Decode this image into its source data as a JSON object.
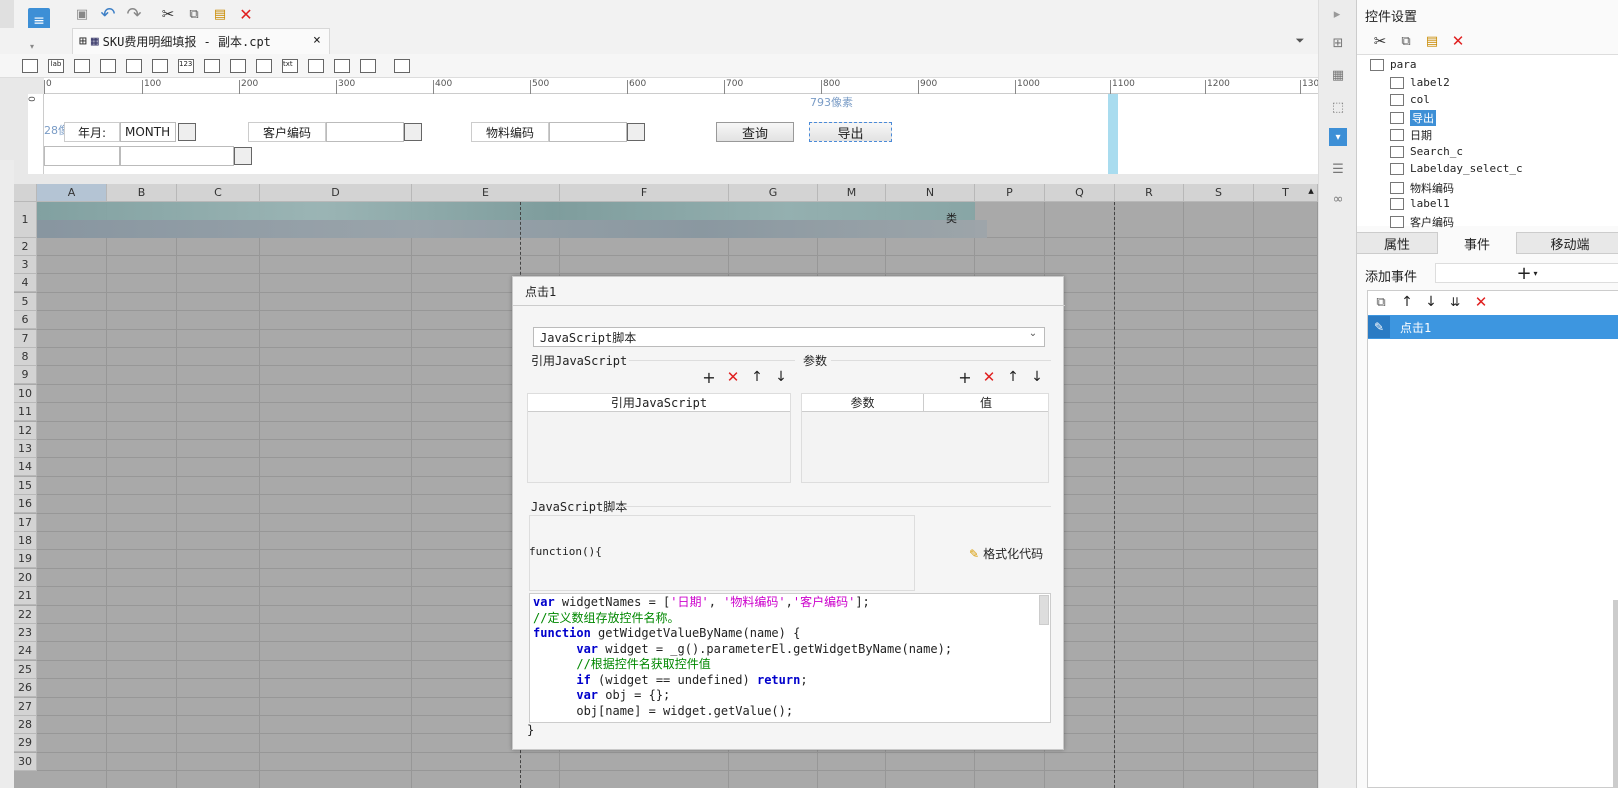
{
  "window": {
    "doc_tab_title": "SKU费用明细填报 - 副本.cpt",
    "tab_close": "×"
  },
  "ruler": {
    "ticks": [
      "0",
      "100",
      "200",
      "300",
      "400",
      "500",
      "600",
      "700",
      "800",
      "900",
      "1000",
      "1100",
      "1200",
      "130"
    ],
    "left": "0"
  },
  "param": {
    "px793": "793像素",
    "px28": "28像素",
    "label_yearmonth": "年月:",
    "yearmonth_value": "MONTH",
    "label_customer": "客户编码",
    "label_material": "物料编码",
    "btn_query": "查询",
    "btn_export": "导出"
  },
  "grid": {
    "columns": [
      "A",
      "B",
      "C",
      "D",
      "E",
      "F",
      "G",
      "M",
      "N",
      "P",
      "Q",
      "R",
      "S",
      "T"
    ],
    "rows": [
      "1",
      "2",
      "3",
      "4",
      "5",
      "6",
      "7",
      "8",
      "9",
      "10",
      "11",
      "12",
      "13",
      "14",
      "15",
      "16",
      "17",
      "18",
      "19",
      "20",
      "21",
      "22",
      "23",
      "24",
      "25",
      "26",
      "27",
      "28",
      "29",
      "30"
    ],
    "cell_suffix": "类"
  },
  "dialog": {
    "title": "点击1",
    "type_select": "JavaScript脚本",
    "section_ref": "引用JavaScript",
    "section_params": "参数",
    "col_ref": "引用JavaScript",
    "col_param": "参数",
    "col_value": "值",
    "section_script": "JavaScript脚本",
    "fn_header": "function(){",
    "format_code": "格式化代码",
    "fn_footer": "}"
  },
  "code_lines": {
    "l1a": "var",
    "l1b": " widgetNames = [",
    "l1c": "'日期'",
    "l1d": ", ",
    "l1e": "'物料编码'",
    "l1f": ",",
    "l1g": "'客户编码'",
    "l1h": "];",
    "l2": "//定义数组存放控件名称。",
    "l3a": "function",
    "l3b": " getWidgetValueByName(name) {",
    "l4a": "      var",
    "l4b": " widget = _g().parameterEl.getWidgetByName(name);",
    "l5": "      //根据控件名获取控件值",
    "l6a": "      if",
    "l6b": " (widget == undefined) ",
    "l6c": "return",
    "l6d": ";",
    "l7a": "      var",
    "l7b": " obj = {};",
    "l8": "      obj[name] = widget.getValue();"
  },
  "panel": {
    "title": "控件设置",
    "tree": [
      "para",
      "label2",
      "col",
      "导出",
      "日期",
      "Search_c",
      "Labelday_select_c",
      "物料编码",
      "label1",
      "客户编码"
    ],
    "tab_props": "属性",
    "tab_events": "事件",
    "tab_move": "移动端",
    "add_event": "添加事件",
    "event_item": "点击1"
  }
}
